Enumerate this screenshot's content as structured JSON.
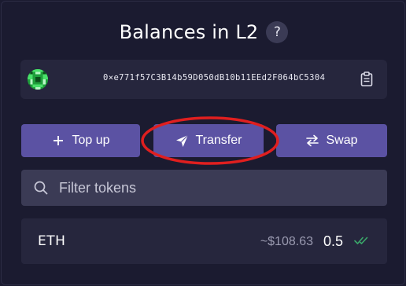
{
  "header": {
    "title": "Balances in L2",
    "help_glyph": "?"
  },
  "account": {
    "address": "0×e771f57C3B14b59D050dB10b11EEd2F064bC5304",
    "avatar_icon": "identicon",
    "copy_icon": "clipboard-icon"
  },
  "actions": {
    "topup_label": "Top up",
    "topup_icon": "plus-icon",
    "transfer_label": "Transfer",
    "transfer_icon": "paper-plane-icon",
    "swap_label": "Swap",
    "swap_icon": "swap-arrows-icon"
  },
  "filter": {
    "placeholder": "Filter tokens",
    "value": ""
  },
  "tokens": [
    {
      "symbol": "ETH",
      "usd_value": "~$108.63",
      "amount": "0.5",
      "status_icon": "double-check-icon"
    }
  ],
  "colors": {
    "background": "#1b1b30",
    "card": "#26263d",
    "button": "#5b52a3",
    "input": "#3b3b55",
    "check": "#3aa86a",
    "highlight": "#e01f1f"
  }
}
